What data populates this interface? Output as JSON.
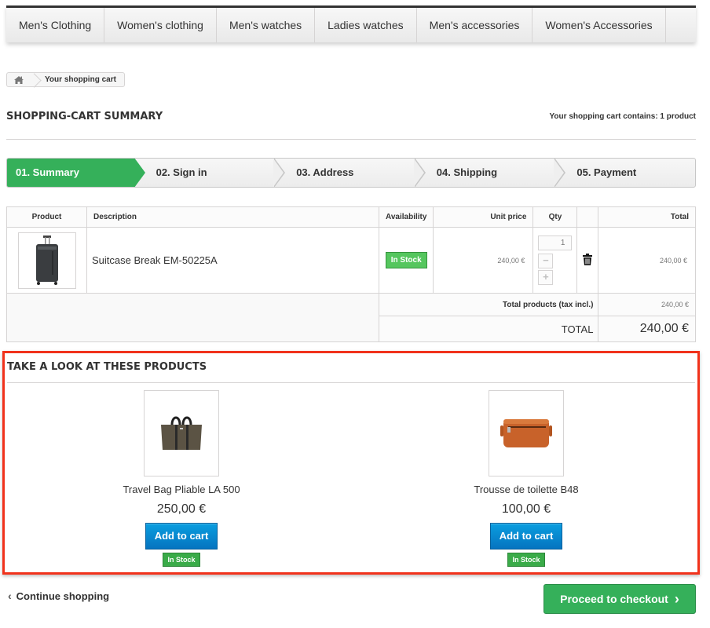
{
  "nav": {
    "items": [
      {
        "label": "Men's Clothing"
      },
      {
        "label": "Women's clothing"
      },
      {
        "label": "Men's watches"
      },
      {
        "label": "Ladies watches"
      },
      {
        "label": "Men's accessories"
      },
      {
        "label": "Women's Accessories"
      }
    ]
  },
  "breadcrumb": {
    "home_icon": "home-icon",
    "current": "Your shopping cart"
  },
  "heading": {
    "title": "SHOPPING-CART SUMMARY",
    "cart_count": "Your shopping cart contains: 1 product"
  },
  "steps": [
    {
      "label": "01. Summary",
      "active": true
    },
    {
      "label": "02. Sign in",
      "active": false
    },
    {
      "label": "03. Address",
      "active": false
    },
    {
      "label": "04. Shipping",
      "active": false
    },
    {
      "label": "05. Payment",
      "active": false
    }
  ],
  "cart": {
    "columns": {
      "product": "Product",
      "description": "Description",
      "availability": "Availability",
      "unit_price": "Unit price",
      "qty": "Qty",
      "total": "Total"
    },
    "rows": [
      {
        "description": "Suitcase Break EM-50225A",
        "availability": "In Stock",
        "unit_price": "240,00 €",
        "qty": "1",
        "qty_minus": "−",
        "qty_plus": "+",
        "delete_icon": "trash-icon",
        "total": "240,00 €"
      }
    ],
    "total_products_label": "Total products (tax incl.)",
    "total_products_value": "240,00 €",
    "total_label": "TOTAL",
    "total_value": "240,00 €"
  },
  "crosssell": {
    "title": "TAKE A LOOK AT THESE PRODUCTS",
    "products": [
      {
        "name": "Travel Bag Pliable LA 500",
        "price": "250,00 €",
        "button": "Add to cart",
        "availability": "In Stock"
      },
      {
        "name": "Trousse de toilette B48",
        "price": "100,00 €",
        "button": "Add to cart",
        "availability": "In Stock"
      }
    ]
  },
  "actions": {
    "continue": "Continue shopping",
    "checkout": "Proceed to checkout"
  },
  "colors": {
    "accent_green": "#35b05a",
    "button_blue": "#0a8ad4",
    "highlight_red": "#f1321b"
  }
}
